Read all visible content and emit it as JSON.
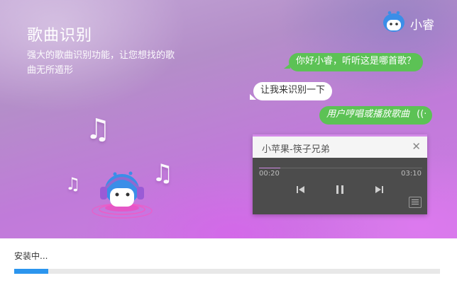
{
  "header": {
    "title": "歌曲识别",
    "subtitle": "强大的歌曲识别功能，让您想找的歌曲无所遁形",
    "brand_name": "小睿",
    "brand_icon": "robot-mascot-icon"
  },
  "chat": {
    "user_question": "你好小睿，听听这是哪首歌？",
    "bot_reply": "让我来识别一下",
    "hint": "用户哼唱或播放歌曲",
    "hint_icon": "sound-wave-icon"
  },
  "player": {
    "song_title": "小苹果-筷子兄弟",
    "elapsed": "00:20",
    "duration": "03:10",
    "progress_fraction": 0.13,
    "icons": [
      "close-icon",
      "previous-track-icon",
      "pause-icon",
      "next-track-icon",
      "playlist-menu-icon"
    ]
  },
  "install": {
    "status_text": "安装中...",
    "progress_fraction": 0.08
  },
  "colors": {
    "bubble_green": "#5cc255",
    "progress_blue": "#2b95ee",
    "player_accent": "#d38ae8",
    "mascot_blue": "#3b8ee8"
  }
}
